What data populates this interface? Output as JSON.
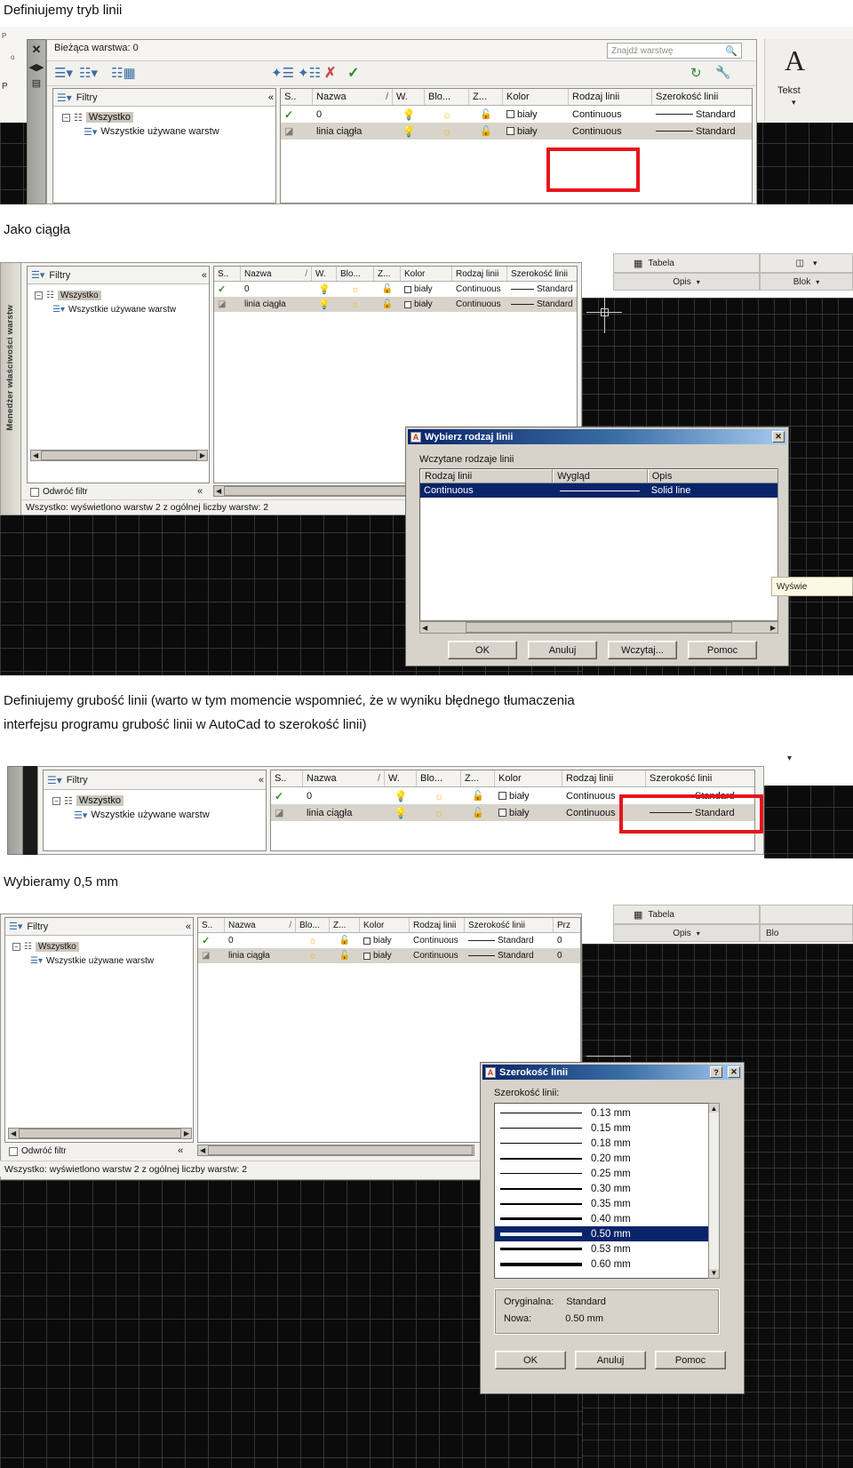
{
  "document": {
    "headings": {
      "h1": "Definiujemy tryb linii",
      "h2": "Jako ciągła",
      "h3_line1": "Definiujemy grubość linii (warto w tym momencie wspomnieć, że w wyniku błędnego tłumaczenia",
      "h3_line2": "interfejsu programu grubość linii w AutoCad to szerokość linii)",
      "h4": "Wybieramy 0,5 mm"
    }
  },
  "layer_manager": {
    "current_layer_label": "Bieżąca warstwa: 0",
    "search_placeholder": "Znajdź warstwę",
    "search_icon": "search-icon",
    "vertical_title": "Menedżer właściwości warstw",
    "filters_pane": {
      "title": "Filtry",
      "collapse_icon": "chevron-double-left-icon",
      "tree": [
        {
          "label": "Wszystko",
          "selected": true
        },
        {
          "label": "Wszystkie używane warstw",
          "selected": false
        }
      ],
      "invert_filter_label": "Odwróć filtr"
    },
    "columns": [
      "S..",
      "Nazwa",
      "W.",
      "Blo...",
      "Z...",
      "Kolor",
      "Rodzaj linii",
      "Szerokość linii"
    ],
    "columns_with_print": [
      "S..",
      "Nazwa",
      "Blo...",
      "Z...",
      "Kolor",
      "Rodzaj linii",
      "Szerokość linii",
      "Prz"
    ],
    "sort_marker": "/",
    "rows": [
      {
        "status_icon": "green-check-icon",
        "name": "0",
        "on_icon": "lightbulb-icon",
        "freeze_icon": "sun-icon",
        "lock_icon": "open-padlock-icon",
        "color": "biały",
        "linetype": "Continuous",
        "lineweight": "Standard",
        "plot": "0"
      },
      {
        "status_icon": "layer-icon",
        "name": "linia ciągła",
        "on_icon": "lightbulb-icon",
        "freeze_icon": "sun-icon",
        "lock_icon": "open-padlock-icon",
        "color": "biały",
        "linetype": "Continuous",
        "lineweight": "Standard",
        "plot": "0"
      }
    ],
    "status_text": "Wszystko: wyświetlono warstw 2 z ogólnej liczby warstw: 2"
  },
  "linetype_dialog": {
    "title": "Wybierz rodzaj linii",
    "close_icon": "close-icon",
    "section_label": "Wczytane rodzaje linii",
    "columns": [
      "Rodzaj linii",
      "Wygląd",
      "Opis"
    ],
    "rows": [
      {
        "name": "Continuous",
        "appearance": "solid-line-preview",
        "description": "Solid line",
        "selected": true
      }
    ],
    "buttons": [
      "OK",
      "Anuluj",
      "Wczytaj...",
      "Pomoc"
    ],
    "tooltip_fragment": "Wyświe"
  },
  "lineweight_dialog": {
    "title": "Szerokość linii",
    "help_icon": "question-mark-icon",
    "close_icon": "close-icon",
    "field_label": "Szerokość linii:",
    "items": [
      {
        "value": "0.13 mm",
        "weight": 1,
        "selected": false
      },
      {
        "value": "0.15 mm",
        "weight": 1,
        "selected": false
      },
      {
        "value": "0.18 mm",
        "weight": 1,
        "selected": false
      },
      {
        "value": "0.20 mm",
        "weight": 2,
        "selected": false
      },
      {
        "value": "0.25 mm",
        "weight": 1,
        "selected": false
      },
      {
        "value": "0.30 mm",
        "weight": 2,
        "selected": false
      },
      {
        "value": "0.35 mm",
        "weight": 2,
        "selected": false
      },
      {
        "value": "0.40 mm",
        "weight": 3,
        "selected": false
      },
      {
        "value": "0.50 mm",
        "weight": 4,
        "selected": true
      },
      {
        "value": "0.53 mm",
        "weight": 3,
        "selected": false
      },
      {
        "value": "0.60 mm",
        "weight": 4,
        "selected": false
      }
    ],
    "original_label": "Oryginalna:",
    "original_value": "Standard",
    "new_label": "Nowa:",
    "new_value": "0.50 mm",
    "buttons": [
      "OK",
      "Anuluj",
      "Pomoc"
    ]
  },
  "ribbon": {
    "text_label": "Tekst",
    "table_label": "Tabela",
    "desc_label": "Opis",
    "block_label": "Blok",
    "block_label_short": "Blo",
    "dropdown_icon": "chevron-down-icon"
  },
  "colors": {
    "highlight_red": "#e8131a",
    "selection_blue": "#0a246a",
    "panel_gray": "#f2f1ee",
    "dialog_gray": "#d7d3ca",
    "row_alt": "#d8d4cb"
  }
}
